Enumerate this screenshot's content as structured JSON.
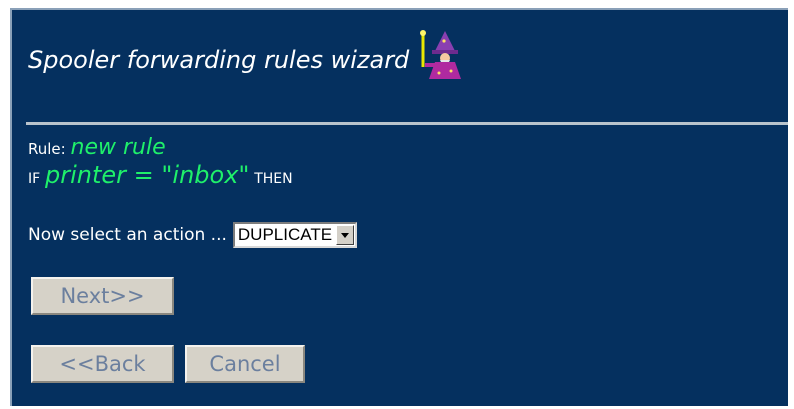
{
  "wizard": {
    "title": "Spooler forwarding rules wizard",
    "icon": "wizard-icon"
  },
  "rule": {
    "label": "Rule:",
    "name": "new rule",
    "if_keyword": "IF",
    "condition": "printer = \"inbox\"",
    "then_keyword": "THEN"
  },
  "action": {
    "prompt": "Now select an action ...",
    "selected": "DUPLICATE"
  },
  "buttons": {
    "next": "Next>>",
    "back": "<<Back",
    "cancel": "Cancel"
  },
  "colors": {
    "background": "#05305f",
    "accent": "#1ff06a",
    "button_face": "#d6d2c8",
    "button_text": "#6b7f9e"
  }
}
